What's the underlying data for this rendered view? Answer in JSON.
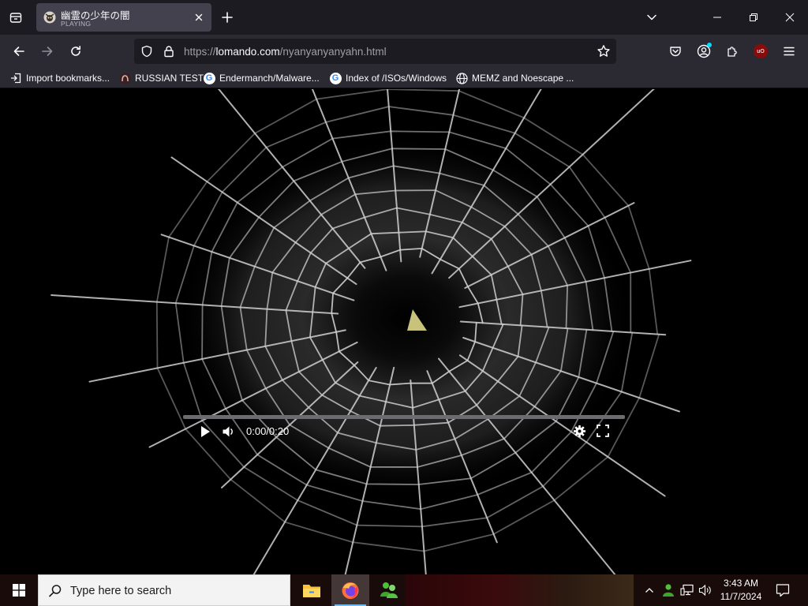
{
  "browser": {
    "tab": {
      "title": "幽霊の少年の闇",
      "status": "PLAYING"
    },
    "address": {
      "scheme": "https://",
      "host": "lomando.com",
      "path": "/nyanyanyanyahn.html"
    }
  },
  "bookmarks": [
    {
      "label": "Import bookmarks...",
      "icon": "import-icon"
    },
    {
      "label": "RUSSIAN TEST",
      "icon": "github-icon"
    },
    {
      "label": "Endermanch/Malware...",
      "icon": "google-icon"
    },
    {
      "label": "Index of /ISOs/Windows",
      "icon": "google-icon"
    },
    {
      "label": "MEMZ and Noescape ...",
      "icon": "globe-icon"
    }
  ],
  "video": {
    "time_display": "0:00/0:20",
    "progress": 0.0
  },
  "taskbar": {
    "search_placeholder": "Type here to search",
    "clock_time": "3:43 AM",
    "clock_date": "11/7/2024",
    "apps": [
      "file-explorer-icon",
      "firefox-icon",
      "msn-messenger-icon"
    ]
  },
  "colors": {
    "tab_bar": "#1c1b22",
    "nav_bar": "#2b2a33",
    "selected_tab": "#42414d",
    "url_field": "#1c1b22",
    "accent": "#00ddff",
    "ublock_red": "#8a0b0b"
  }
}
